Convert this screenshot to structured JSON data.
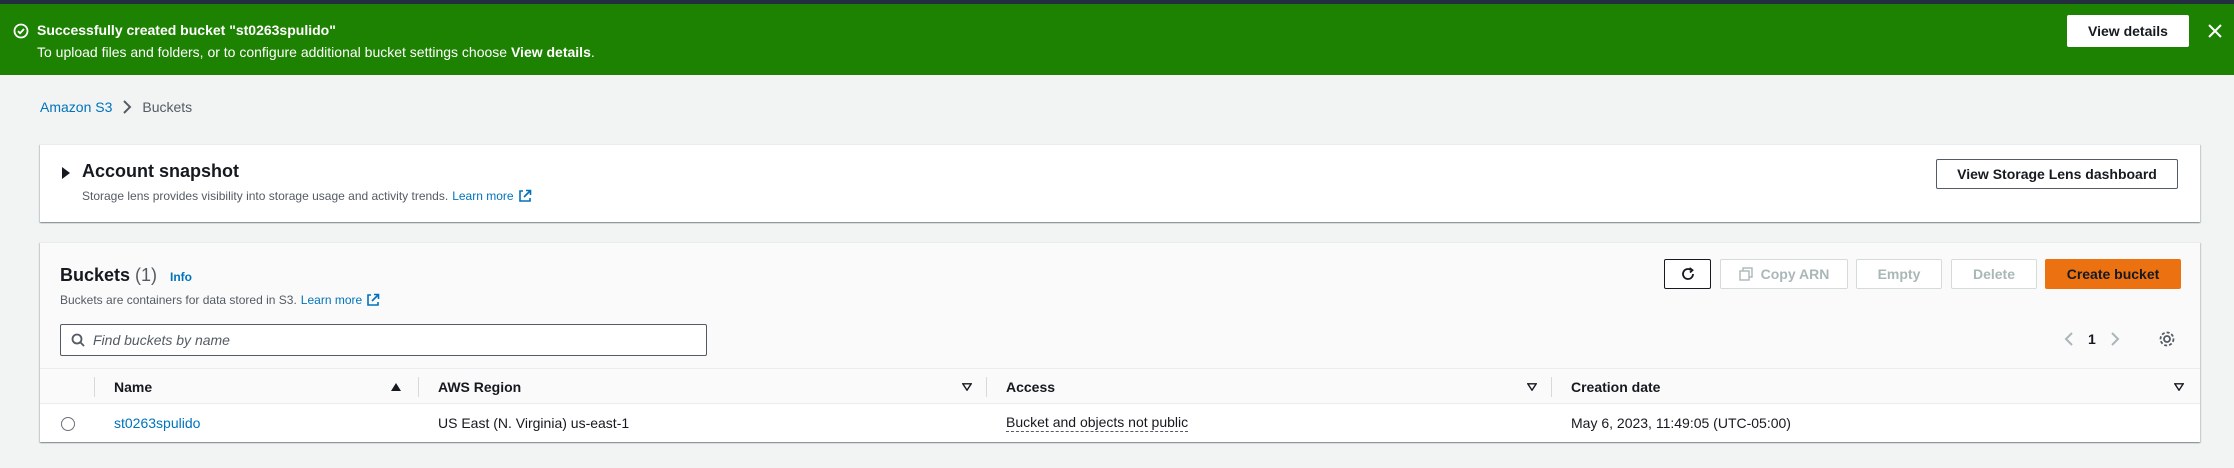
{
  "flash": {
    "title": "Successfully created bucket \"st0263spulido\"",
    "body_prefix": "To upload files and folders, or to configure additional bucket settings choose",
    "body_link": "View details",
    "body_suffix": ".",
    "view_details_label": "View details",
    "color": "#1d8102"
  },
  "breadcrumb": {
    "root": "Amazon S3",
    "current": "Buckets"
  },
  "snapshot": {
    "title": "Account snapshot",
    "desc": "Storage lens provides visibility into storage usage and activity trends.",
    "learn_more": "Learn more",
    "lens_button": "View Storage Lens dashboard"
  },
  "buckets": {
    "title": "Buckets",
    "count": "(1)",
    "info": "Info",
    "desc": "Buckets are containers for data stored in S3.",
    "learn_more": "Learn more",
    "copy_arn": "Copy ARN",
    "empty": "Empty",
    "delete": "Delete",
    "create": "Create bucket",
    "search_placeholder": "Find buckets by name",
    "page": "1",
    "columns": [
      "Name",
      "AWS Region",
      "Access",
      "Creation date"
    ],
    "rows": [
      {
        "name": "st0263spulido",
        "region": "US East (N. Virginia) us-east-1",
        "access": "Bucket and objects not public",
        "created": "May 6, 2023, 11:49:05 (UTC-05:00)"
      }
    ]
  },
  "colors": {
    "accent": "#ec7211",
    "link": "#0073bb"
  }
}
